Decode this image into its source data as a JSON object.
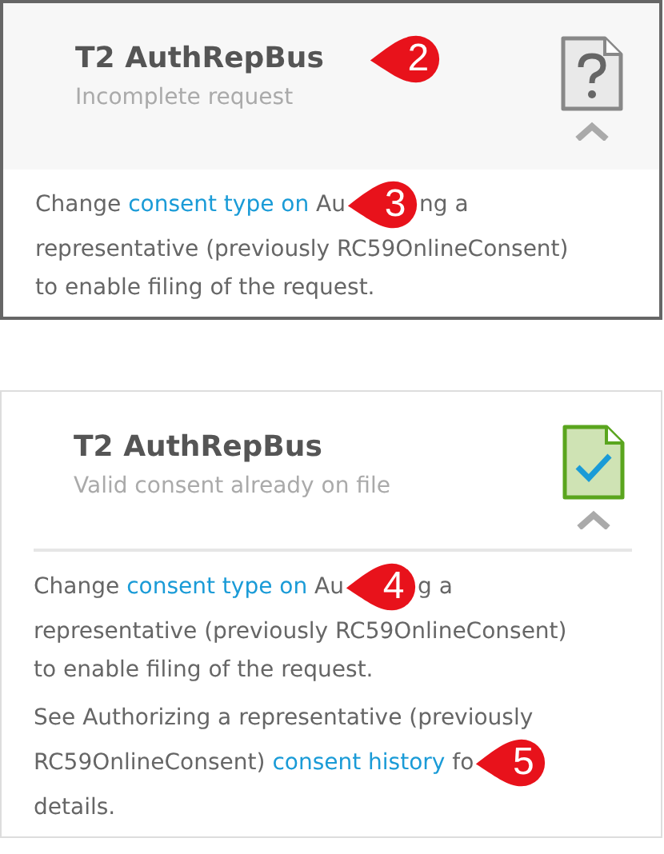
{
  "cards": [
    {
      "selected": true,
      "title": "T2 AuthRepBus",
      "status": "Incomplete request",
      "kind": "incomplete",
      "callout": "2",
      "paragraphs": [
        {
          "lines": [
            [
              {
                "kind": "text",
                "text": "Change "
              },
              {
                "kind": "link",
                "text": "consent type on"
              },
              {
                "kind": "text",
                "text": " Au"
              },
              {
                "kind": "callout",
                "text": "3"
              },
              {
                "kind": "text",
                "text": "ng a"
              }
            ],
            [
              {
                "kind": "text",
                "text": "representative (previously RC59OnlineConsent)"
              }
            ],
            [
              {
                "kind": "text",
                "text": "to enable filing of the request."
              }
            ]
          ]
        }
      ]
    },
    {
      "selected": false,
      "title": "T2 AuthRepBus",
      "status": "Valid consent already on file",
      "kind": "valid",
      "paragraphs": [
        {
          "lines": [
            [
              {
                "kind": "text",
                "text": "Change "
              },
              {
                "kind": "link",
                "text": "consent type on"
              },
              {
                "kind": "text",
                "text": " Au"
              },
              {
                "kind": "callout",
                "text": "4"
              },
              {
                "kind": "text",
                "text": "g a"
              }
            ],
            [
              {
                "kind": "text",
                "text": "representative (previously RC59OnlineConsent)"
              }
            ],
            [
              {
                "kind": "text",
                "text": "to enable filing of the request."
              }
            ]
          ]
        },
        {
          "lines": [
            [
              {
                "kind": "text",
                "text": "See Authorizing a representative (previously"
              }
            ],
            [
              {
                "kind": "text",
                "text": "RC59OnlineConsent) "
              },
              {
                "kind": "link",
                "text": "consent history"
              },
              {
                "kind": "text",
                "text": " fo"
              },
              {
                "kind": "callout",
                "text": "5"
              }
            ],
            [
              {
                "kind": "text",
                "text": "details."
              }
            ]
          ]
        }
      ]
    }
  ]
}
